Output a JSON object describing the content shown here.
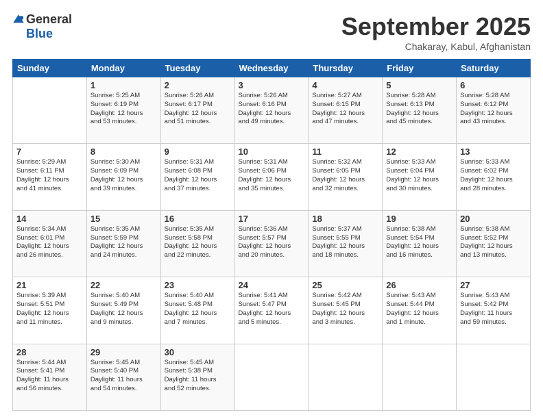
{
  "logo": {
    "general": "General",
    "blue": "Blue"
  },
  "title": "September 2025",
  "subtitle": "Chakaray, Kabul, Afghanistan",
  "days_header": [
    "Sunday",
    "Monday",
    "Tuesday",
    "Wednesday",
    "Thursday",
    "Friday",
    "Saturday"
  ],
  "weeks": [
    [
      {
        "day": "",
        "info": ""
      },
      {
        "day": "1",
        "info": "Sunrise: 5:25 AM\nSunset: 6:19 PM\nDaylight: 12 hours\nand 53 minutes."
      },
      {
        "day": "2",
        "info": "Sunrise: 5:26 AM\nSunset: 6:17 PM\nDaylight: 12 hours\nand 51 minutes."
      },
      {
        "day": "3",
        "info": "Sunrise: 5:26 AM\nSunset: 6:16 PM\nDaylight: 12 hours\nand 49 minutes."
      },
      {
        "day": "4",
        "info": "Sunrise: 5:27 AM\nSunset: 6:15 PM\nDaylight: 12 hours\nand 47 minutes."
      },
      {
        "day": "5",
        "info": "Sunrise: 5:28 AM\nSunset: 6:13 PM\nDaylight: 12 hours\nand 45 minutes."
      },
      {
        "day": "6",
        "info": "Sunrise: 5:28 AM\nSunset: 6:12 PM\nDaylight: 12 hours\nand 43 minutes."
      }
    ],
    [
      {
        "day": "7",
        "info": "Sunrise: 5:29 AM\nSunset: 6:11 PM\nDaylight: 12 hours\nand 41 minutes."
      },
      {
        "day": "8",
        "info": "Sunrise: 5:30 AM\nSunset: 6:09 PM\nDaylight: 12 hours\nand 39 minutes."
      },
      {
        "day": "9",
        "info": "Sunrise: 5:31 AM\nSunset: 6:08 PM\nDaylight: 12 hours\nand 37 minutes."
      },
      {
        "day": "10",
        "info": "Sunrise: 5:31 AM\nSunset: 6:06 PM\nDaylight: 12 hours\nand 35 minutes."
      },
      {
        "day": "11",
        "info": "Sunrise: 5:32 AM\nSunset: 6:05 PM\nDaylight: 12 hours\nand 32 minutes."
      },
      {
        "day": "12",
        "info": "Sunrise: 5:33 AM\nSunset: 6:04 PM\nDaylight: 12 hours\nand 30 minutes."
      },
      {
        "day": "13",
        "info": "Sunrise: 5:33 AM\nSunset: 6:02 PM\nDaylight: 12 hours\nand 28 minutes."
      }
    ],
    [
      {
        "day": "14",
        "info": "Sunrise: 5:34 AM\nSunset: 6:01 PM\nDaylight: 12 hours\nand 26 minutes."
      },
      {
        "day": "15",
        "info": "Sunrise: 5:35 AM\nSunset: 5:59 PM\nDaylight: 12 hours\nand 24 minutes."
      },
      {
        "day": "16",
        "info": "Sunrise: 5:35 AM\nSunset: 5:58 PM\nDaylight: 12 hours\nand 22 minutes."
      },
      {
        "day": "17",
        "info": "Sunrise: 5:36 AM\nSunset: 5:57 PM\nDaylight: 12 hours\nand 20 minutes."
      },
      {
        "day": "18",
        "info": "Sunrise: 5:37 AM\nSunset: 5:55 PM\nDaylight: 12 hours\nand 18 minutes."
      },
      {
        "day": "19",
        "info": "Sunrise: 5:38 AM\nSunset: 5:54 PM\nDaylight: 12 hours\nand 16 minutes."
      },
      {
        "day": "20",
        "info": "Sunrise: 5:38 AM\nSunset: 5:52 PM\nDaylight: 12 hours\nand 13 minutes."
      }
    ],
    [
      {
        "day": "21",
        "info": "Sunrise: 5:39 AM\nSunset: 5:51 PM\nDaylight: 12 hours\nand 11 minutes."
      },
      {
        "day": "22",
        "info": "Sunrise: 5:40 AM\nSunset: 5:49 PM\nDaylight: 12 hours\nand 9 minutes."
      },
      {
        "day": "23",
        "info": "Sunrise: 5:40 AM\nSunset: 5:48 PM\nDaylight: 12 hours\nand 7 minutes."
      },
      {
        "day": "24",
        "info": "Sunrise: 5:41 AM\nSunset: 5:47 PM\nDaylight: 12 hours\nand 5 minutes."
      },
      {
        "day": "25",
        "info": "Sunrise: 5:42 AM\nSunset: 5:45 PM\nDaylight: 12 hours\nand 3 minutes."
      },
      {
        "day": "26",
        "info": "Sunrise: 5:43 AM\nSunset: 5:44 PM\nDaylight: 12 hours\nand 1 minute."
      },
      {
        "day": "27",
        "info": "Sunrise: 5:43 AM\nSunset: 5:42 PM\nDaylight: 11 hours\nand 59 minutes."
      }
    ],
    [
      {
        "day": "28",
        "info": "Sunrise: 5:44 AM\nSunset: 5:41 PM\nDaylight: 11 hours\nand 56 minutes."
      },
      {
        "day": "29",
        "info": "Sunrise: 5:45 AM\nSunset: 5:40 PM\nDaylight: 11 hours\nand 54 minutes."
      },
      {
        "day": "30",
        "info": "Sunrise: 5:45 AM\nSunset: 5:38 PM\nDaylight: 11 hours\nand 52 minutes."
      },
      {
        "day": "",
        "info": ""
      },
      {
        "day": "",
        "info": ""
      },
      {
        "day": "",
        "info": ""
      },
      {
        "day": "",
        "info": ""
      }
    ]
  ]
}
